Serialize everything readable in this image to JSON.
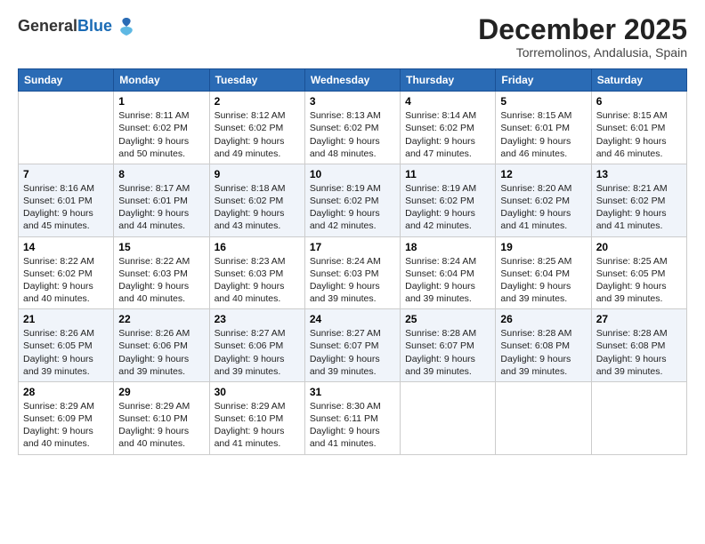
{
  "header": {
    "logo_general": "General",
    "logo_blue": "Blue",
    "month_title": "December 2025",
    "subtitle": "Torremolinos, Andalusia, Spain"
  },
  "weekdays": [
    "Sunday",
    "Monday",
    "Tuesday",
    "Wednesday",
    "Thursday",
    "Friday",
    "Saturday"
  ],
  "weeks": [
    [
      {
        "day": "",
        "info": ""
      },
      {
        "day": "1",
        "info": "Sunrise: 8:11 AM\nSunset: 6:02 PM\nDaylight: 9 hours\nand 50 minutes."
      },
      {
        "day": "2",
        "info": "Sunrise: 8:12 AM\nSunset: 6:02 PM\nDaylight: 9 hours\nand 49 minutes."
      },
      {
        "day": "3",
        "info": "Sunrise: 8:13 AM\nSunset: 6:02 PM\nDaylight: 9 hours\nand 48 minutes."
      },
      {
        "day": "4",
        "info": "Sunrise: 8:14 AM\nSunset: 6:02 PM\nDaylight: 9 hours\nand 47 minutes."
      },
      {
        "day": "5",
        "info": "Sunrise: 8:15 AM\nSunset: 6:01 PM\nDaylight: 9 hours\nand 46 minutes."
      },
      {
        "day": "6",
        "info": "Sunrise: 8:15 AM\nSunset: 6:01 PM\nDaylight: 9 hours\nand 46 minutes."
      }
    ],
    [
      {
        "day": "7",
        "info": "Sunrise: 8:16 AM\nSunset: 6:01 PM\nDaylight: 9 hours\nand 45 minutes."
      },
      {
        "day": "8",
        "info": "Sunrise: 8:17 AM\nSunset: 6:01 PM\nDaylight: 9 hours\nand 44 minutes."
      },
      {
        "day": "9",
        "info": "Sunrise: 8:18 AM\nSunset: 6:02 PM\nDaylight: 9 hours\nand 43 minutes."
      },
      {
        "day": "10",
        "info": "Sunrise: 8:19 AM\nSunset: 6:02 PM\nDaylight: 9 hours\nand 42 minutes."
      },
      {
        "day": "11",
        "info": "Sunrise: 8:19 AM\nSunset: 6:02 PM\nDaylight: 9 hours\nand 42 minutes."
      },
      {
        "day": "12",
        "info": "Sunrise: 8:20 AM\nSunset: 6:02 PM\nDaylight: 9 hours\nand 41 minutes."
      },
      {
        "day": "13",
        "info": "Sunrise: 8:21 AM\nSunset: 6:02 PM\nDaylight: 9 hours\nand 41 minutes."
      }
    ],
    [
      {
        "day": "14",
        "info": "Sunrise: 8:22 AM\nSunset: 6:02 PM\nDaylight: 9 hours\nand 40 minutes."
      },
      {
        "day": "15",
        "info": "Sunrise: 8:22 AM\nSunset: 6:03 PM\nDaylight: 9 hours\nand 40 minutes."
      },
      {
        "day": "16",
        "info": "Sunrise: 8:23 AM\nSunset: 6:03 PM\nDaylight: 9 hours\nand 40 minutes."
      },
      {
        "day": "17",
        "info": "Sunrise: 8:24 AM\nSunset: 6:03 PM\nDaylight: 9 hours\nand 39 minutes."
      },
      {
        "day": "18",
        "info": "Sunrise: 8:24 AM\nSunset: 6:04 PM\nDaylight: 9 hours\nand 39 minutes."
      },
      {
        "day": "19",
        "info": "Sunrise: 8:25 AM\nSunset: 6:04 PM\nDaylight: 9 hours\nand 39 minutes."
      },
      {
        "day": "20",
        "info": "Sunrise: 8:25 AM\nSunset: 6:05 PM\nDaylight: 9 hours\nand 39 minutes."
      }
    ],
    [
      {
        "day": "21",
        "info": "Sunrise: 8:26 AM\nSunset: 6:05 PM\nDaylight: 9 hours\nand 39 minutes."
      },
      {
        "day": "22",
        "info": "Sunrise: 8:26 AM\nSunset: 6:06 PM\nDaylight: 9 hours\nand 39 minutes."
      },
      {
        "day": "23",
        "info": "Sunrise: 8:27 AM\nSunset: 6:06 PM\nDaylight: 9 hours\nand 39 minutes."
      },
      {
        "day": "24",
        "info": "Sunrise: 8:27 AM\nSunset: 6:07 PM\nDaylight: 9 hours\nand 39 minutes."
      },
      {
        "day": "25",
        "info": "Sunrise: 8:28 AM\nSunset: 6:07 PM\nDaylight: 9 hours\nand 39 minutes."
      },
      {
        "day": "26",
        "info": "Sunrise: 8:28 AM\nSunset: 6:08 PM\nDaylight: 9 hours\nand 39 minutes."
      },
      {
        "day": "27",
        "info": "Sunrise: 8:28 AM\nSunset: 6:08 PM\nDaylight: 9 hours\nand 39 minutes."
      }
    ],
    [
      {
        "day": "28",
        "info": "Sunrise: 8:29 AM\nSunset: 6:09 PM\nDaylight: 9 hours\nand 40 minutes."
      },
      {
        "day": "29",
        "info": "Sunrise: 8:29 AM\nSunset: 6:10 PM\nDaylight: 9 hours\nand 40 minutes."
      },
      {
        "day": "30",
        "info": "Sunrise: 8:29 AM\nSunset: 6:10 PM\nDaylight: 9 hours\nand 41 minutes."
      },
      {
        "day": "31",
        "info": "Sunrise: 8:30 AM\nSunset: 6:11 PM\nDaylight: 9 hours\nand 41 minutes."
      },
      {
        "day": "",
        "info": ""
      },
      {
        "day": "",
        "info": ""
      },
      {
        "day": "",
        "info": ""
      }
    ]
  ]
}
